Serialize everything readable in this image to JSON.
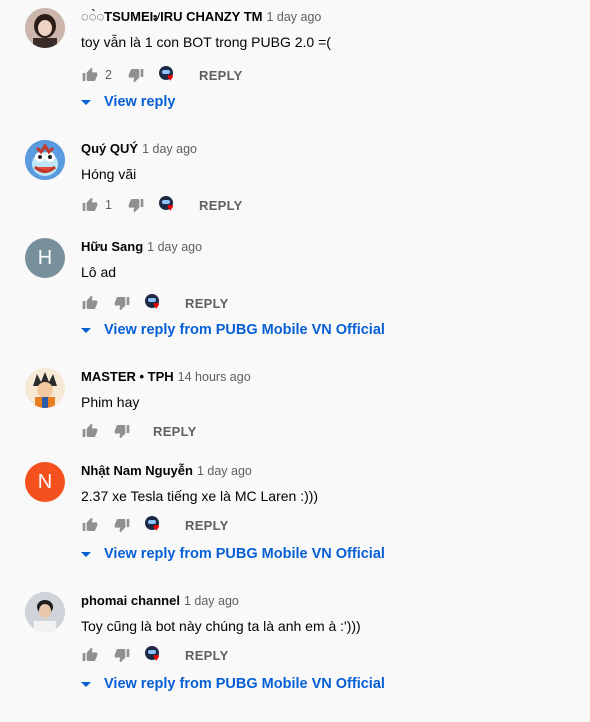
{
  "comments": [
    {
      "author": "◌◌̀◌TSUMEI৶IRU CHANZY TM",
      "time": "1 day ago",
      "text": "toy vẫn là 1 con BOT trong PUBG 2.0 =(",
      "likes": "2",
      "avatar": {
        "type": "photo",
        "bg": "#d8c3b8",
        "icon": "person-photo"
      },
      "reply_label": "REPLY",
      "creator_heart": true,
      "view_reply": "View reply"
    },
    {
      "author": "Quý QUÝ",
      "time": "1 day ago",
      "text": "Hóng vãi",
      "likes": "1",
      "avatar": {
        "type": "cartoon",
        "bg": "#4a8fd8",
        "icon": "cartoon-face"
      },
      "reply_label": "REPLY",
      "creator_heart": true
    },
    {
      "author": "Hữu Sang",
      "time": "1 day ago",
      "text": "Lô ad",
      "likes": "",
      "avatar": {
        "type": "letter",
        "letter": "H",
        "bg": "#78909c"
      },
      "reply_label": "REPLY",
      "creator_heart": true,
      "view_reply": "View reply from PUBG Mobile VN Official"
    },
    {
      "author": "MASTER • TPH",
      "time": "14 hours ago",
      "text": "Phim hay",
      "likes": "",
      "avatar": {
        "type": "cartoon",
        "bg": "#f3e2c6",
        "icon": "anime-character"
      },
      "reply_label": "REPLY",
      "creator_heart": false
    },
    {
      "author": "Nhật Nam Nguyễn",
      "time": "1 day ago",
      "text": "2.37 xe Tesla tiếng xe là MC Laren :)))",
      "likes": "",
      "avatar": {
        "type": "letter",
        "letter": "N",
        "bg": "#f4511e"
      },
      "reply_label": "REPLY",
      "creator_heart": true,
      "view_reply": "View reply from PUBG Mobile VN Official"
    },
    {
      "author": "phomai channel",
      "time": "1 day ago",
      "text": "Toy cũng là bot này chúng ta là anh em à :')))",
      "likes": "",
      "avatar": {
        "type": "photo",
        "bg": "#c9ccd3",
        "icon": "person-photo"
      },
      "reply_label": "REPLY",
      "creator_heart": true,
      "view_reply": "View reply from PUBG Mobile VN Official"
    }
  ],
  "colors": {
    "link": "#065fd4",
    "secondary": "#606060",
    "heart": "#e00000",
    "background": "#f9f9f9"
  }
}
